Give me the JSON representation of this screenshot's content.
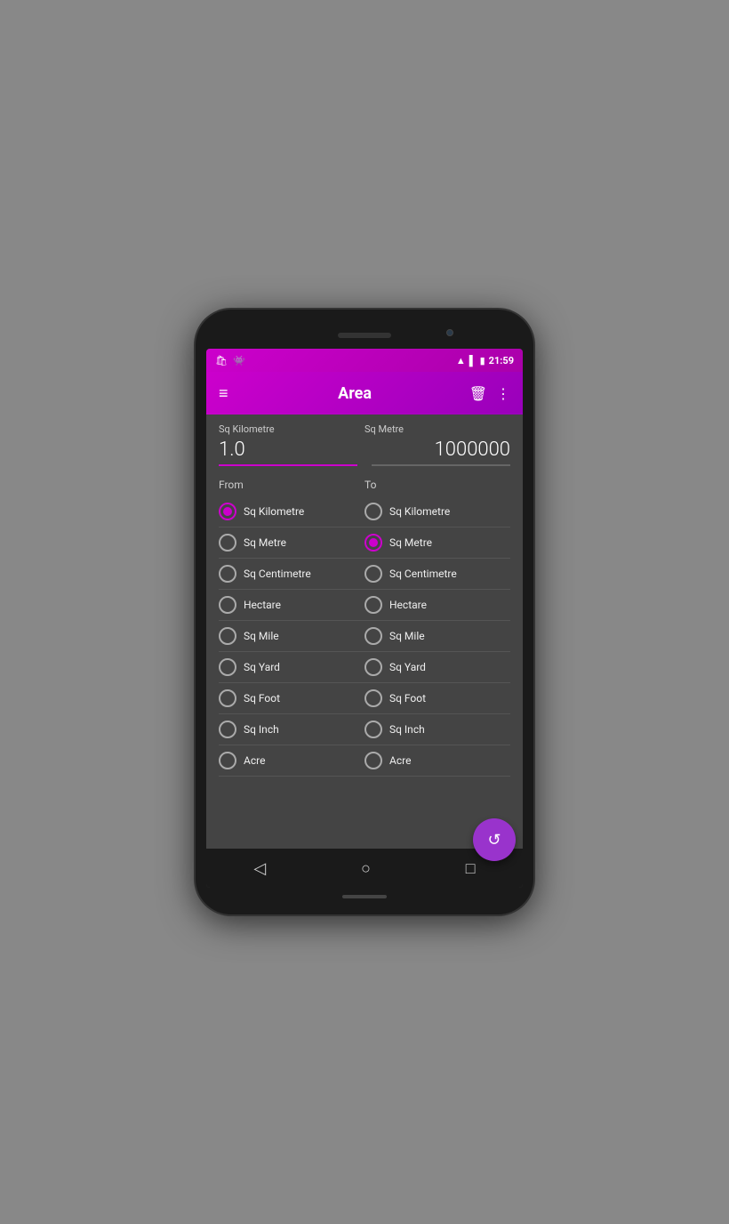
{
  "statusBar": {
    "time": "21:59",
    "wifiIcon": "wifi",
    "signalIcon": "signal",
    "batteryIcon": "battery"
  },
  "appBar": {
    "title": "Area",
    "menuIcon": "≡",
    "deleteIcon": "🗑",
    "moreIcon": "⋮"
  },
  "inputs": {
    "fromLabel": "Sq Kilometre",
    "fromValue": "1.0",
    "toLabel": "Sq Metre",
    "toValue": "1000000"
  },
  "fromLabel": "From",
  "toLabel": "To",
  "units": [
    {
      "label": "Sq Kilometre",
      "fromSelected": true,
      "toSelected": false
    },
    {
      "label": "Sq Metre",
      "fromSelected": false,
      "toSelected": true
    },
    {
      "label": "Sq Centimetre",
      "fromSelected": false,
      "toSelected": false
    },
    {
      "label": "Hectare",
      "fromSelected": false,
      "toSelected": false
    },
    {
      "label": "Sq Mile",
      "fromSelected": false,
      "toSelected": false
    },
    {
      "label": "Sq Yard",
      "fromSelected": false,
      "toSelected": false
    },
    {
      "label": "Sq Foot",
      "fromSelected": false,
      "toSelected": false
    },
    {
      "label": "Sq Inch",
      "fromSelected": false,
      "toSelected": false
    },
    {
      "label": "Acre",
      "fromSelected": false,
      "toSelected": false
    }
  ],
  "fab": {
    "icon": "↺"
  },
  "nav": {
    "back": "◁",
    "home": "○",
    "recent": "□"
  }
}
